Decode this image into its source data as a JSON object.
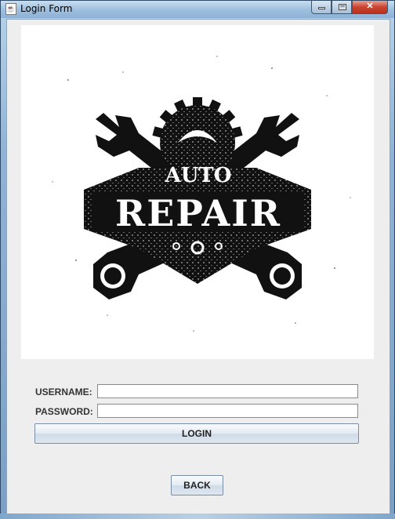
{
  "window": {
    "title": "Login Form",
    "app_icon": "java-icon"
  },
  "logo": {
    "line1": "AUTO",
    "line2": "REPAIR",
    "icon": "auto-repair-logo"
  },
  "form": {
    "username_label": "USERNAME:",
    "username_value": "",
    "password_label": "PASSWORD:",
    "password_value": "",
    "login_label": "LOGIN",
    "back_label": "BACK"
  },
  "colors": {
    "client_bg": "#eeeeee",
    "logo_ink": "#111111"
  }
}
